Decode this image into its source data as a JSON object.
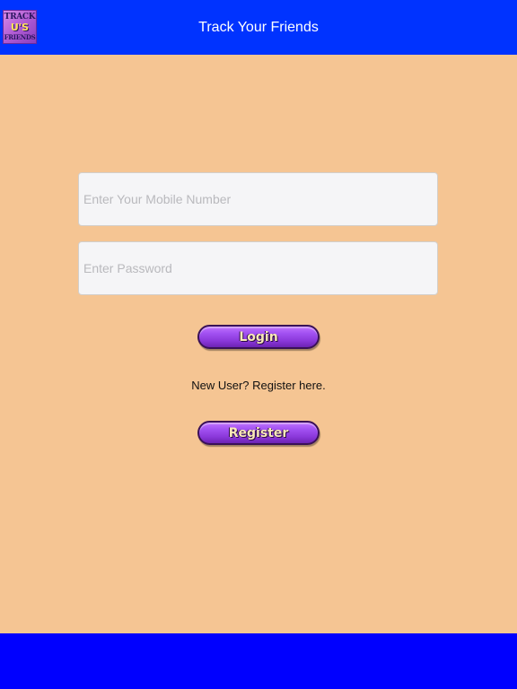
{
  "header": {
    "title": "Track Your Friends",
    "logo": {
      "line1": "TRACK",
      "line2": "U'S",
      "line3": "FRIENDS"
    }
  },
  "form": {
    "mobile_placeholder": "Enter Your Mobile Number",
    "mobile_value": "",
    "password_placeholder": "Enter Password",
    "password_value": "",
    "login_label": "Login",
    "new_user_text": "New User? Register here.",
    "register_label": "Register"
  },
  "colors": {
    "header_bg": "#0033ff",
    "page_bg": "#f5c593",
    "footer_bg": "#0000ff",
    "button_purple": "#9b4cf0"
  }
}
